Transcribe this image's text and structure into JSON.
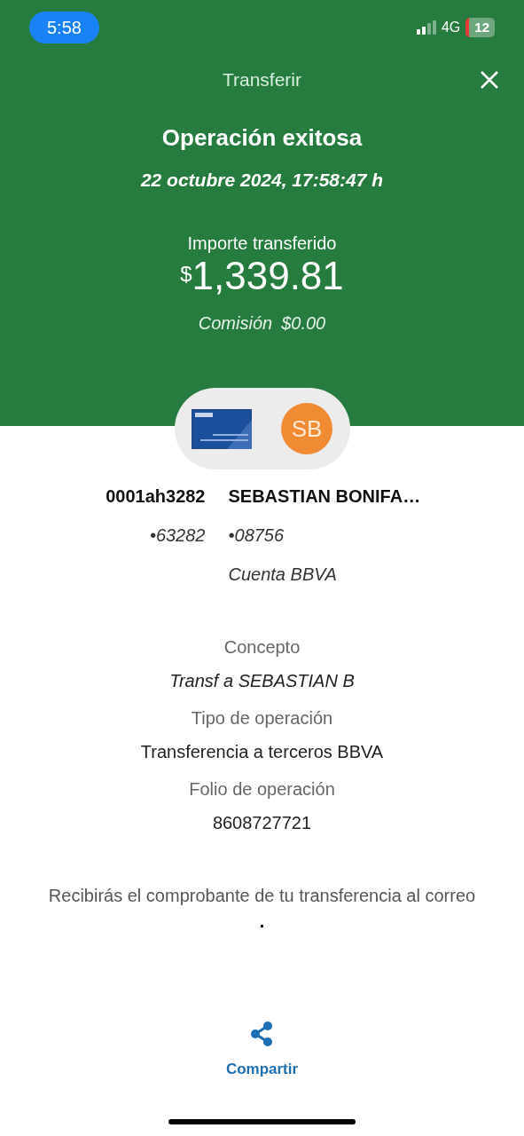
{
  "status_bar": {
    "time": "5:58",
    "network": "4G",
    "battery": "12"
  },
  "header": {
    "title": "Transferir"
  },
  "result": {
    "title": "Operación exitosa",
    "date": "22 octubre 2024, 17:58:47 h",
    "amount_label": "Importe transferido",
    "currency_symbol": "$",
    "amount": "1,339.81",
    "fee_label": "Comisión",
    "fee": "$0.00"
  },
  "origin": {
    "name": "0001ah3282",
    "account": "•63282"
  },
  "destination": {
    "initials": "SB",
    "name": "SEBASTIAN BONIFA…",
    "account": "•08756",
    "bank": "Cuenta BBVA"
  },
  "details": [
    {
      "label": "Concepto",
      "value": "Transf a SEBASTIAN B",
      "italic": true
    },
    {
      "label": "Tipo de operación",
      "value": "Transferencia a terceros BBVA",
      "italic": false
    },
    {
      "label": "Folio de operación",
      "value": "8608727721",
      "italic": false
    }
  ],
  "notice": "Recibirás el comprobante de tu transferencia al correo",
  "email": ".",
  "share": {
    "label": "Compartir"
  }
}
